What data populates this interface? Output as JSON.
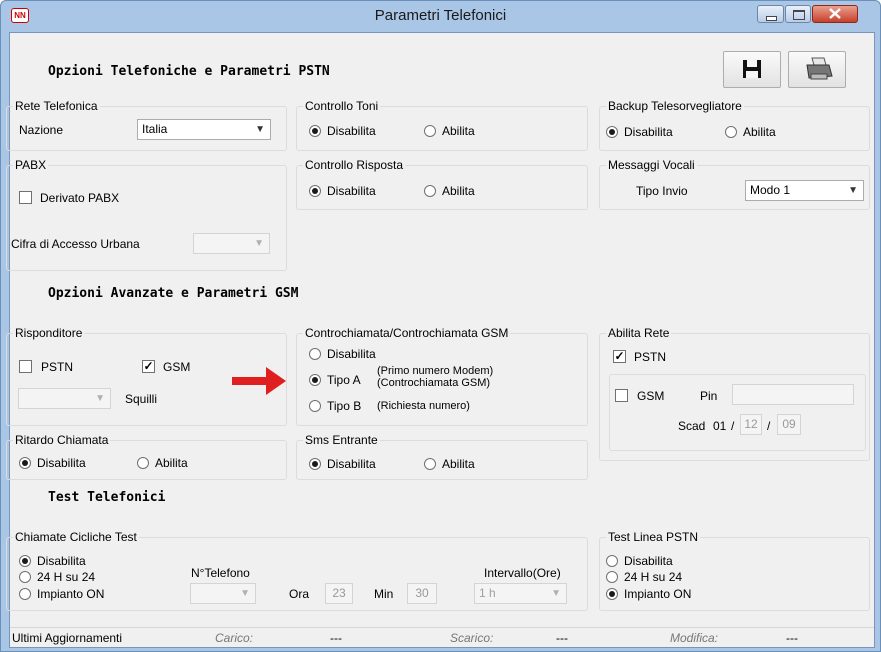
{
  "window": {
    "title": "Parametri Telefonici",
    "app_icon": "NN",
    "accent": "#c7402a"
  },
  "sections": {
    "pstn": "Opzioni Telefoniche e Parametri PSTN",
    "gsm": "Opzioni Avanzate e Parametri GSM",
    "test": "Test Telefonici"
  },
  "toolbar": {
    "save_icon": "floppy-disk-icon",
    "print_icon": "printer-icon"
  },
  "rete": {
    "title": "Rete Telefonica",
    "label": "Nazione",
    "value": "Italia"
  },
  "controllo_toni": {
    "title": "Controllo Toni",
    "opt1": "Disabilita",
    "opt2": "Abilita",
    "selected": "Disabilita"
  },
  "backup": {
    "title": "Backup Telesorvegliatore",
    "opt1": "Disabilita",
    "opt2": "Abilita",
    "selected": "Disabilita"
  },
  "pabx": {
    "title": "PABX",
    "check_label": "Derivato PABX",
    "checked": false,
    "cifra_label": "Cifra di Accesso Urbana",
    "cifra_value": ""
  },
  "controllo_risposta": {
    "title": "Controllo Risposta",
    "opt1": "Disabilita",
    "opt2": "Abilita",
    "selected": "Disabilita"
  },
  "messaggi": {
    "title": "Messaggi Vocali",
    "label": "Tipo Invio",
    "value": "Modo 1"
  },
  "risponditore": {
    "title": "Risponditore",
    "pstn": "PSTN",
    "gsm": "GSM",
    "pstn_checked": false,
    "gsm_checked": true,
    "squilli_label": "Squilli",
    "squilli_value": ""
  },
  "controchiamata": {
    "title": "Controchiamata/Controchiamata GSM",
    "opt1": "Disabilita",
    "opt2": "Tipo A",
    "opt2_note1": "(Primo numero Modem)",
    "opt2_note2": "(Controchiamata GSM)",
    "opt3": "Tipo B",
    "opt3_note": "(Richiesta numero)",
    "selected": "Tipo A"
  },
  "abilita_rete": {
    "title": "Abilita Rete",
    "pstn": "PSTN",
    "pstn_checked": true,
    "gsm": "GSM",
    "gsm_checked": false,
    "pin_label": "Pin",
    "pin_value": "",
    "scad_label": "Scad",
    "scad_day": "01",
    "sep": "/",
    "scad_month": "12",
    "scad_year": "09"
  },
  "ritardo": {
    "title": "Ritardo Chiamata",
    "opt1": "Disabilita",
    "opt2": "Abilita",
    "selected": "Disabilita"
  },
  "sms": {
    "title": "Sms Entrante",
    "opt1": "Disabilita",
    "opt2": "Abilita",
    "selected": "Disabilita"
  },
  "cicliche": {
    "title": "Chiamate Cicliche Test",
    "opt1": "Disabilita",
    "opt2": "24 H su 24",
    "opt3": "Impianto ON",
    "selected": "Disabilita",
    "telefono_label": "N°Telefono",
    "telefono_value": "",
    "ora_label": "Ora",
    "ora_value": "23",
    "min_label": "Min",
    "min_value": "30",
    "intervallo_label": "Intervallo(Ore)",
    "intervallo_value": "1 h"
  },
  "test_linea": {
    "title": "Test Linea PSTN",
    "opt1": "Disabilita",
    "opt2": "24 H su 24",
    "opt3": "Impianto ON",
    "selected": "Impianto ON"
  },
  "status": {
    "label": "Ultimi Aggiornamenti",
    "carico_label": "Carico:",
    "carico_value": "---",
    "scarico_label": "Scarico:",
    "scarico_value": "---",
    "modifica_label": "Modifica:",
    "modifica_value": "---"
  }
}
